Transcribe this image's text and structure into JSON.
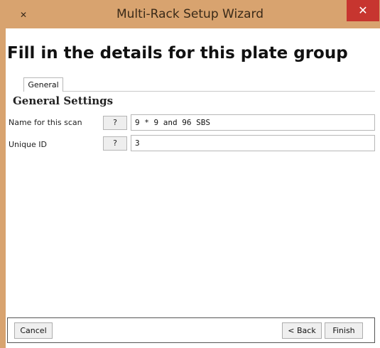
{
  "window": {
    "title": "Multi-Rack Setup Wizard",
    "icon": "app-icon",
    "close_label": "✕"
  },
  "page": {
    "heading": "Fill in the details for this plate group"
  },
  "tabs": [
    {
      "label": "General",
      "selected": true
    }
  ],
  "section": {
    "title": "General Settings"
  },
  "fields": [
    {
      "label": "Name for this scan",
      "help_label": "?",
      "value": "9 * 9 and 96 SBS"
    },
    {
      "label": "Unique ID",
      "help_label": "?",
      "value": "3"
    }
  ],
  "footer": {
    "cancel_label": "Cancel",
    "back_label": "< Back",
    "finish_label": "Finish"
  },
  "colors": {
    "title_bar": "#d8a36f",
    "close_button": "#c7352f"
  }
}
